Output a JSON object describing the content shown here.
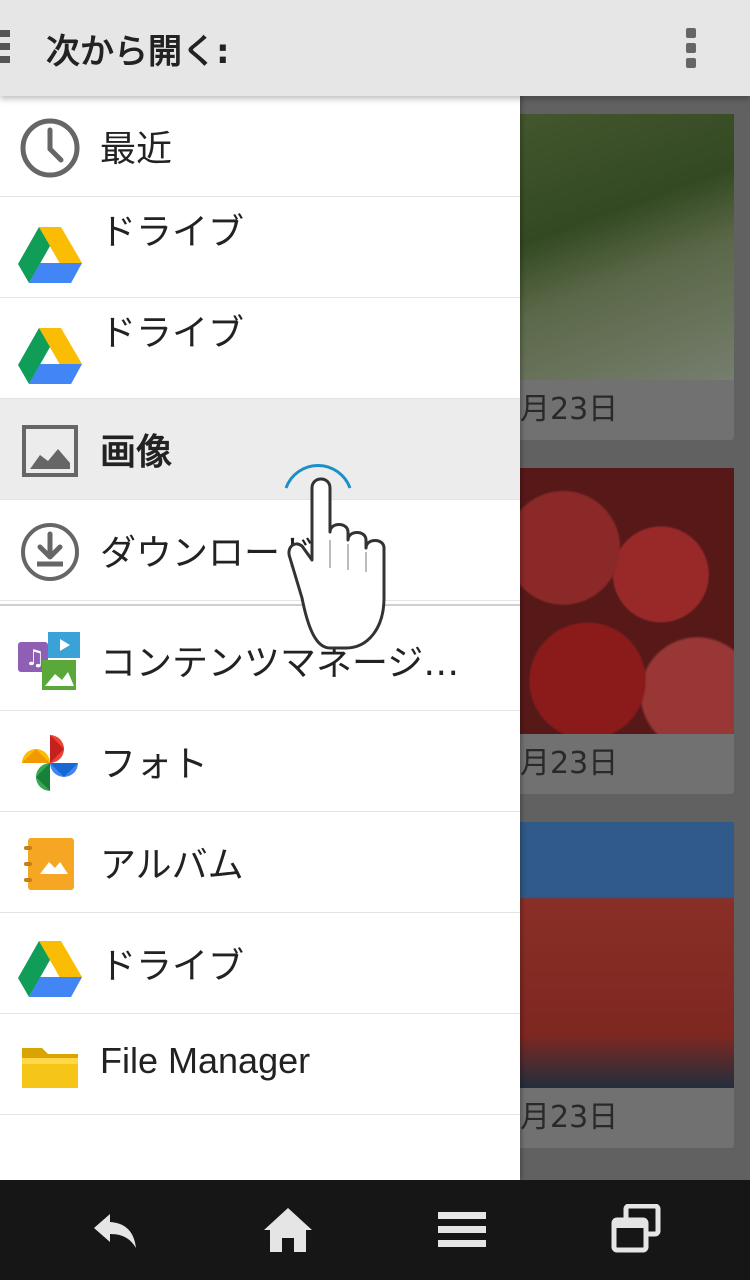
{
  "appbar": {
    "title": "次から開く:",
    "menu_icon": "overflow-menu-icon"
  },
  "drawer": {
    "items": [
      {
        "label": "最近",
        "icon": "clock-icon"
      },
      {
        "label": "ドライブ",
        "icon": "google-drive-icon"
      },
      {
        "label": "ドライブ",
        "icon": "google-drive-icon"
      },
      {
        "label": "画像",
        "icon": "image-icon",
        "selected": true
      },
      {
        "label": "ダウンロード",
        "icon": "download-icon"
      },
      {
        "label": "コンテンツマネージ…",
        "icon": "content-manager-icon"
      },
      {
        "label": "フォト",
        "icon": "google-photos-icon"
      },
      {
        "label": "アルバム",
        "icon": "album-icon"
      },
      {
        "label": "ドライブ",
        "icon": "google-drive-icon"
      },
      {
        "label": "File Manager",
        "icon": "folder-icon"
      }
    ]
  },
  "gallery": {
    "cards": [
      {
        "date": "月23日"
      },
      {
        "date": "月23日"
      },
      {
        "date": "月23日"
      }
    ]
  },
  "navbar": {
    "buttons": [
      "back-icon",
      "home-icon",
      "menu-icon",
      "recent-apps-icon"
    ]
  },
  "colors": {
    "appbar_bg": "#e6e6e6",
    "drawer_bg": "#ffffff",
    "selected_bg": "#ececec",
    "navbar_bg": "#161616",
    "touch_ring": "#1a8fc8"
  }
}
